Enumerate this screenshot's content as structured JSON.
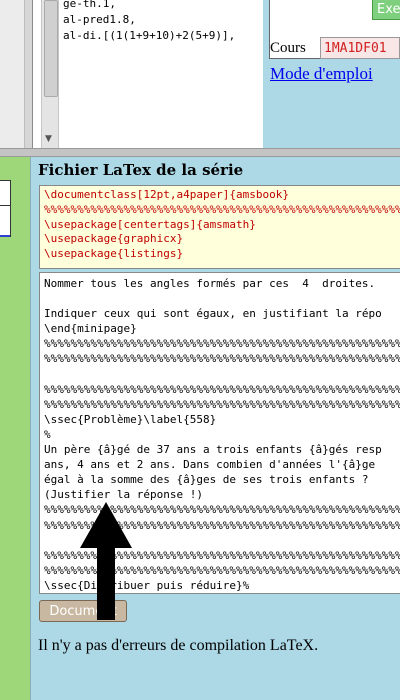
{
  "code_panel": {
    "lines": "ge-th.1,\nal-pred1.8,\nal-di.[(1(1+9+10)+2(5+9)],"
  },
  "top_right": {
    "exe_label": "Exe",
    "cours_label": "Cours",
    "cours_value": "1MA1DF01",
    "mode_emploi_link": "Mode d'emploi"
  },
  "main": {
    "title": "Fichier LaTex de la série",
    "preamble": "\\documentclass[12pt,a4paper]{amsbook}\n%%%%%%%%%%%%%%%%%%%%%%%%%%%%%%%%%%%%%%%%%%%%%%%%%%%%%%%%\n\\usepackage[centertags]{amsmath}\n\\usepackage{graphicx}\n\\usepackage{listings}",
    "body": "Nommer tous les angles formés par ces  4  droites.\n\nIndiquer ceux qui sont égaux, en justifiant la répo\n\\end{minipage}\n%%%%%%%%%%%%%%%%%%%%%%%%%%%%%%%%%%%%%%%%%%%%%%%%%%%%%%%%\n%%%%%%%%%%%%%%%%%%%%%%%%%%%%%%%%%%%%%%%%%%%%%%%%%%%%%%%\n\n%%%%%%%%%%%%%%%%%%%%%%%%%%%%%%%%%%%%%%%%%%%%%%%%%%%%%%%%\n%%%%%%%%%%%%%%%%%%%%%%%%%%%%%%%%%%%%%%%%%%%%%%%%%%%%%%%%\n\\ssec{Problème}\\label{558}\n%\nUn père {â}gé de 37 ans a trois enfants {â}gés resp\nans, 4 ans et 2 ans. Dans combien d'années l'{â}ge\négal à la somme des {â}ges de ses trois enfants ?\n(Justifier la réponse !)\n%%%%%%%%%%%%%%%%%%%%%%%%%%%%%%%%%%%%%%%%%%%%%%%%%%%%%%%%\n%%%%%%%%%%%%%%%%%%%%%%%%%%%%%%%%%%%%%%%%%%%%%%%%%%%%%%%%\n\n%%%%%%%%%%%%%%%%%%%%%%%%%%%%%%%%%%%%%%%%%%%%%%%%%%%%%%%%\n%%%%%%%%%%%%%%%%%%%%%%%%%%%%%%%%%%%%%%%%%%%%%%%%%%%%%%%%\n\\ssec{Distribuer puis réduire}%",
    "document_button": "Document",
    "status": "Il n'y a pas d'erreurs de compilation LaTeX."
  }
}
